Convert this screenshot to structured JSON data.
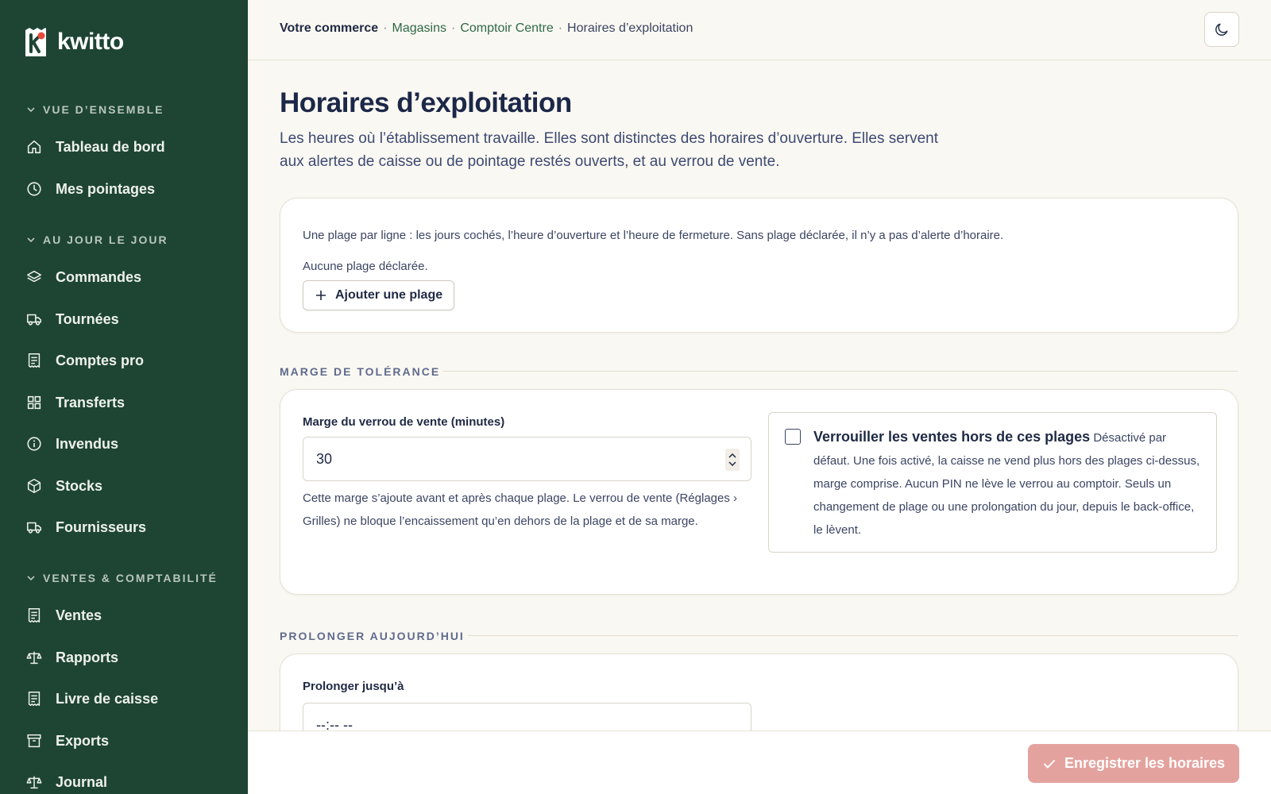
{
  "app": {
    "name": "kwitto"
  },
  "sidebar": {
    "sections": [
      {
        "label": "VUE D’ENSEMBLE",
        "items": [
          {
            "label": "Tableau de bord",
            "icon": "home-icon"
          },
          {
            "label": "Mes pointages",
            "icon": "clock-icon"
          }
        ]
      },
      {
        "label": "AU JOUR LE JOUR",
        "items": [
          {
            "label": "Commandes",
            "icon": "layers-icon"
          },
          {
            "label": "Tournées",
            "icon": "truck-icon"
          },
          {
            "label": "Comptes pro",
            "icon": "receipt-icon"
          },
          {
            "label": "Transferts",
            "icon": "grid-icon"
          },
          {
            "label": "Invendus",
            "icon": "info-icon"
          },
          {
            "label": "Stocks",
            "icon": "box-icon"
          },
          {
            "label": "Fournisseurs",
            "icon": "truck-icon"
          }
        ]
      },
      {
        "label": "VENTES & COMPTABILITÉ",
        "items": [
          {
            "label": "Ventes",
            "icon": "receipt-icon"
          },
          {
            "label": "Rapports",
            "icon": "scale-icon"
          },
          {
            "label": "Livre de caisse",
            "icon": "receipt-icon"
          },
          {
            "label": "Exports",
            "icon": "archive-icon"
          },
          {
            "label": "Journal",
            "icon": "scale-icon"
          }
        ]
      }
    ]
  },
  "breadcrumb": {
    "root": "Votre commerce",
    "sep": "·",
    "level1": "Magasins",
    "level2": "Comptoir Centre",
    "current": "Horaires d’exploitation"
  },
  "page": {
    "title": "Horaires d’exploitation",
    "description": "Les heures où l’établissement travaille. Elles sont distinctes des horaires d’ouverture. Elles servent aux alertes de caisse ou de pointage restés ouverts, et au verrou de vente."
  },
  "ranges": {
    "intro": "Une plage par ligne : les jours cochés, l’heure d’ouverture et l’heure de fermeture. Sans plage déclarée, il n’y a pas d’alerte d’horaire.",
    "empty": "Aucune plage déclarée.",
    "add_label": "Ajouter une plage"
  },
  "tolerance": {
    "section_label": "MARGE DE TOLÉRANCE",
    "field_label": "Marge du verrou de vente (minutes)",
    "value": "30",
    "help": "Cette marge s’ajoute avant et après chaque plage. Le verrou de vente (Réglages › Grilles) ne bloque l’encaissement qu’en dehors de la plage et de sa marge.",
    "lock_title": "Verrouiller les ventes hors de ces plages",
    "lock_default": "Désactivé par défaut.",
    "lock_description": "Une fois activé, la caisse ne vend plus hors des plages ci-dessus, marge comprise. Aucun PIN ne lève le verrou au comptoir. Seuls un changement de plage ou une prolongation du jour, depuis le back-office, le lèvent.",
    "lock_checked": false
  },
  "extend": {
    "section_label": "PROLONGER AUJOURD’HUI",
    "field_label": "Prolonger jusqu’à",
    "placeholder": "--:-- --"
  },
  "footer": {
    "save_label": "Enregistrer les horaires"
  },
  "colors": {
    "sidebar_bg": "#1e4534",
    "accent_green": "#2f6a45",
    "save_button": "#e4a29e",
    "title": "#1c2848",
    "page_bg": "#faf8f2"
  }
}
